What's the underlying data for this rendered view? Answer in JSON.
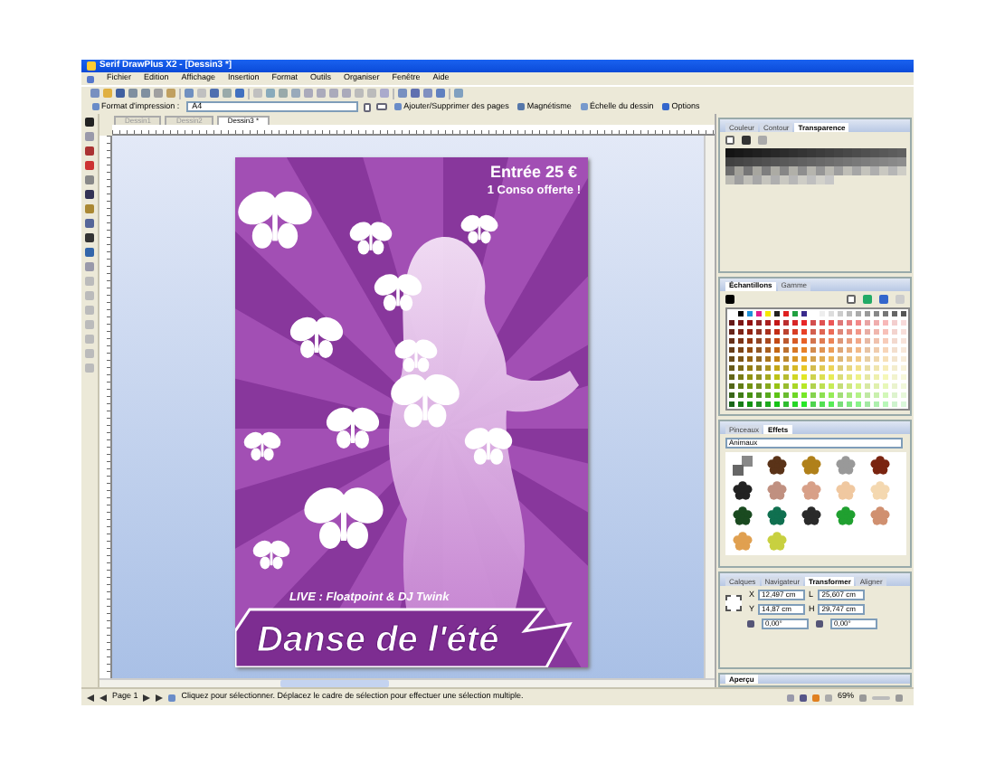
{
  "window": {
    "title": "Serif DrawPlus X2 - [Dessin3 *]"
  },
  "menu": [
    "Fichier",
    "Edition",
    "Affichage",
    "Insertion",
    "Format",
    "Outils",
    "Organiser",
    "Fenêtre",
    "Aide"
  ],
  "context_bar": {
    "format_label": "Format d'impression :",
    "format_value": "A4",
    "buttons": [
      "Ajouter/Supprimer des pages",
      "Magnétisme",
      "Échelle du dessin",
      "Options"
    ]
  },
  "document_tabs": [
    {
      "label": "Dessin1",
      "selected": false
    },
    {
      "label": "Dessin2",
      "selected": false
    },
    {
      "label": "Dessin3 *",
      "selected": true
    }
  ],
  "poster": {
    "price": "Entrée 25 €",
    "offer": "1 Conso offerte !",
    "lineup": "LIVE : Floatpoint & DJ Twink",
    "title": "Danse de l'été"
  },
  "panels": [
    {
      "kind": "transparency",
      "tabs": [
        {
          "label": "Couleur",
          "selected": false
        },
        {
          "label": "Contour",
          "selected": false
        },
        {
          "label": "Transparence",
          "selected": true
        }
      ]
    },
    {
      "kind": "swatches",
      "tabs": [
        {
          "label": "Échantillons",
          "selected": true
        },
        {
          "label": "Gamme",
          "selected": false
        }
      ]
    },
    {
      "kind": "effects",
      "tabs": [
        {
          "label": "Pinceaux",
          "selected": false
        },
        {
          "label": "Effets",
          "selected": true
        }
      ],
      "category": "Animaux"
    },
    {
      "kind": "transform",
      "tabs": [
        {
          "label": "Calques",
          "selected": false
        },
        {
          "label": "Navigateur",
          "selected": false
        },
        {
          "label": "Transformer",
          "selected": true
        },
        {
          "label": "Aligner",
          "selected": false
        }
      ],
      "fields": [
        {
          "label": "X",
          "value": "12,497 cm"
        },
        {
          "label": "L",
          "value": "25,607 cm"
        },
        {
          "label": "Y",
          "value": "14,87 cm"
        },
        {
          "label": "H",
          "value": "29,747 cm"
        }
      ],
      "rotation": "0,00°",
      "shear": "0,00°"
    },
    {
      "kind": "preview",
      "tabs": [
        {
          "label": "Aperçu",
          "selected": true
        }
      ]
    }
  ],
  "status_bar": {
    "page": "Page 1",
    "hint": "Cliquez pour sélectionner. Déplacez le cadre de sélection pour effectuer une sélection multiple.",
    "zoom": "69%"
  }
}
